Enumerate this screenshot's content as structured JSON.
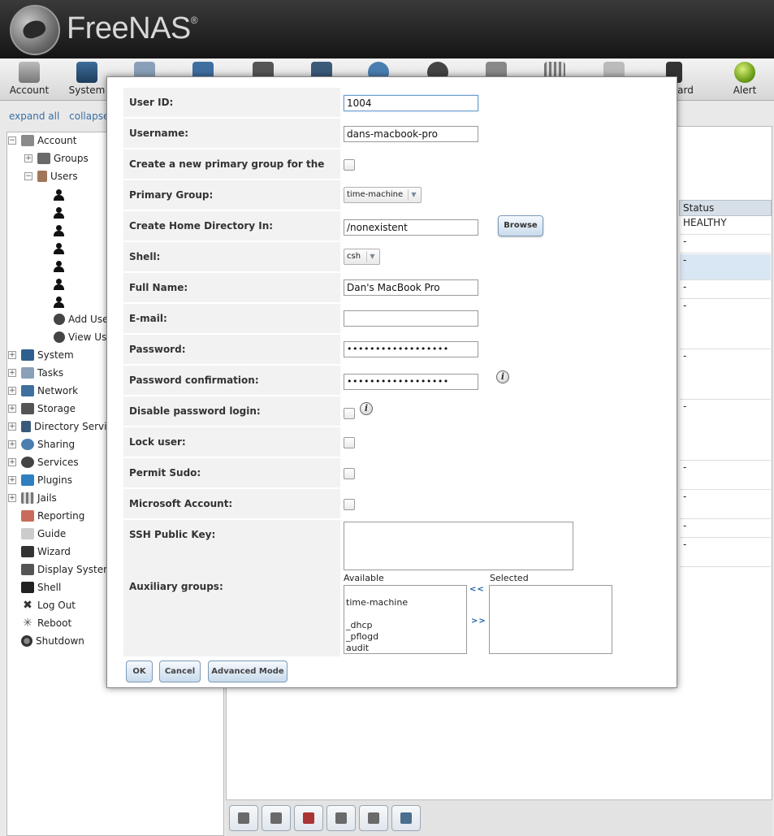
{
  "app": {
    "title": "FreeNAS",
    "trademark": "®"
  },
  "toolbar": {
    "items": [
      {
        "label": "Account",
        "icon": "account-icon"
      },
      {
        "label": "System",
        "icon": "system-icon"
      },
      {
        "label": "",
        "icon": "tasks-icon"
      },
      {
        "label": "",
        "icon": "network-icon"
      },
      {
        "label": "",
        "icon": "storage-icon"
      },
      {
        "label": "",
        "icon": "directory-icon"
      },
      {
        "label": "",
        "icon": "sharing-icon"
      },
      {
        "label": "",
        "icon": "services-icon"
      },
      {
        "label": "",
        "icon": "plugins-icon"
      },
      {
        "label": "",
        "icon": "jails-icon"
      },
      {
        "label": "",
        "icon": "reporting-icon"
      },
      {
        "label": "ard",
        "icon": "wizard-icon"
      },
      {
        "label": "Alert",
        "icon": "alert-icon"
      }
    ]
  },
  "tree_links": {
    "expand": "expand all",
    "collapse": "collapse a"
  },
  "tree": {
    "account": "Account",
    "groups": "Groups",
    "users": "Users",
    "add_user": "Add Use",
    "view_users": "View Use",
    "system": "System",
    "tasks": "Tasks",
    "network": "Network",
    "storage": "Storage",
    "directory": "Directory Servic",
    "sharing": "Sharing",
    "services": "Services",
    "plugins": "Plugins",
    "jails": "Jails",
    "reporting": "Reporting",
    "guide": "Guide",
    "wizard": "Wizard",
    "display_system": "Display System",
    "shell": "Shell",
    "logout": "Log Out",
    "reboot": "Reboot",
    "shutdown": "Shutdown"
  },
  "status_table": {
    "header": "Status",
    "cells": [
      "HEALTHY",
      "-",
      "-",
      "-",
      "-",
      "-",
      "-",
      "-",
      "-",
      "-",
      "-"
    ]
  },
  "dialog": {
    "user_id": {
      "label": "User ID:",
      "value": "1004"
    },
    "username": {
      "label": "Username:",
      "value": "dans-macbook-pro"
    },
    "new_primary_group": {
      "label": "Create a new primary group for the user:",
      "checked": false
    },
    "primary_group": {
      "label": "Primary Group:",
      "value": "time-machine"
    },
    "home_dir": {
      "label": "Create Home Directory In:",
      "value": "/nonexistent",
      "browse": "Browse"
    },
    "shell": {
      "label": "Shell:",
      "value": "csh"
    },
    "full_name": {
      "label": "Full Name:",
      "value": "Dan's MacBook Pro"
    },
    "email": {
      "label": "E-mail:",
      "value": ""
    },
    "password": {
      "label": "Password:",
      "value": "••••••••••••••••••"
    },
    "password_confirm": {
      "label": "Password confirmation:",
      "value": "••••••••••••••••••"
    },
    "disable_password_login": {
      "label": "Disable password login:",
      "checked": false
    },
    "lock_user": {
      "label": "Lock user:",
      "checked": false
    },
    "permit_sudo": {
      "label": "Permit Sudo:",
      "checked": false
    },
    "microsoft_account": {
      "label": "Microsoft Account:",
      "checked": false
    },
    "ssh_key": {
      "label": "SSH Public Key:",
      "value": ""
    },
    "aux_groups": {
      "label": "Auxiliary groups:",
      "available_label": "Available",
      "selected_label": "Selected",
      "available": [
        "",
        "time-machine",
        "",
        "_dhcp",
        "_pflogd",
        "audit"
      ],
      "move_left": "<<",
      "move_right": ">>"
    },
    "buttons": {
      "ok": "OK",
      "cancel": "Cancel",
      "advanced": "Advanced Mode"
    }
  }
}
